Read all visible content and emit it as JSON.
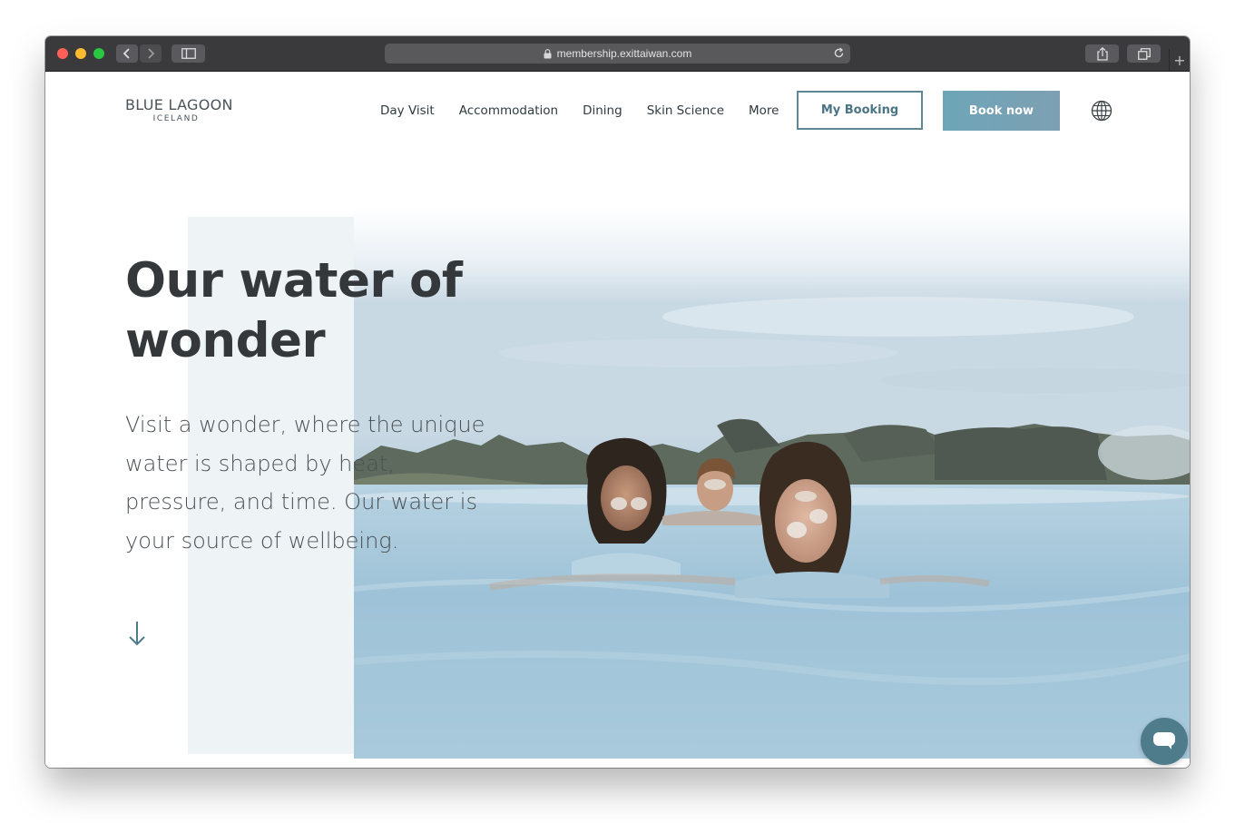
{
  "browser": {
    "url": "membership.exittaiwan.com",
    "new_tab_glyph": "+",
    "icons": [
      "back-icon",
      "forward-icon",
      "sidebar-icon",
      "lock-icon",
      "reload-icon",
      "share-icon",
      "tabs-icon"
    ]
  },
  "site": {
    "logo_main": "BLUE LAGOON",
    "logo_sub": "ICELAND",
    "nav": [
      "Day Visit",
      "Accommodation",
      "Dining",
      "Skin Science",
      "More"
    ],
    "my_booking": "My Booking",
    "book_now": "Book now",
    "language_icon": "globe-icon"
  },
  "hero": {
    "title": "Our water of wonder",
    "text": "Visit a wonder, where the unique water is shaped by heat, pressure, and time. Our water is your source of wellbeing.",
    "scroll_icon": "arrow-down-icon"
  },
  "chat": {
    "icon": "chat-icon"
  },
  "colors": {
    "brand": "#5f8793",
    "button_fill": "#6da5b7",
    "heading": "#34383a",
    "chat": "#4f7c8b"
  }
}
